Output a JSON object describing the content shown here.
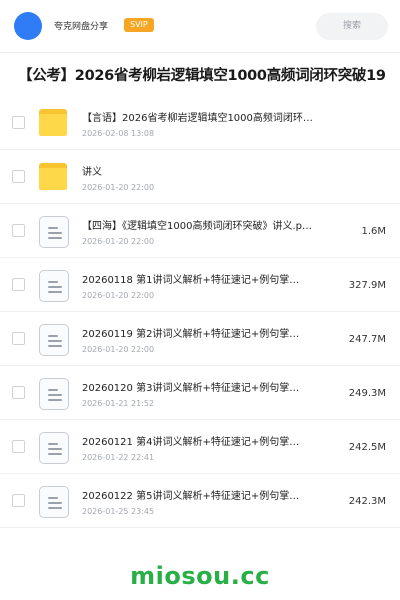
{
  "header": {
    "share_name": "夸克网盘分享",
    "badge": "SVIP",
    "search_placeholder": "搜索",
    "avatar_color": "#2f7cf6",
    "badge_color": "#f6a623"
  },
  "title": "【公考】2026省考柳岩逻辑填空1000高频词闭环突破19",
  "files": [
    {
      "type": "folder",
      "icon": "folder-icon",
      "name": "【言语】2026省考柳岩逻辑填空1000高频词闭环…",
      "date": "2026-02-08 13:08",
      "size": ""
    },
    {
      "type": "folder",
      "icon": "folder-icon",
      "name": "讲义",
      "date": "2026-01-20 22:00",
      "size": ""
    },
    {
      "type": "file",
      "icon": "document-icon",
      "name": "【四海】《逻辑填空1000高频词闭环突破》讲义.p…",
      "date": "2026-01-20 22:00",
      "size": "1.6M"
    },
    {
      "type": "file",
      "icon": "document-icon",
      "name": "20260118 第1讲词义解析+特征速记+例句掌…",
      "date": "2026-01-20 22:00",
      "size": "327.9M"
    },
    {
      "type": "file",
      "icon": "document-icon",
      "name": "20260119 第2讲词义解析+特征速记+例句掌…",
      "date": "2026-01-20 22:00",
      "size": "247.7M"
    },
    {
      "type": "file",
      "icon": "document-icon",
      "name": "20260120 第3讲词义解析+特征速记+例句掌…",
      "date": "2026-01-21 21:52",
      "size": "249.3M"
    },
    {
      "type": "file",
      "icon": "document-icon",
      "name": "20260121 第4讲词义解析+特征速记+例句掌…",
      "date": "2026-01-22 22:41",
      "size": "242.5M"
    },
    {
      "type": "file",
      "icon": "document-icon",
      "name": "20260122 第5讲词义解析+特征速记+例句掌…",
      "date": "2026-01-25 23:45",
      "size": "242.3M"
    }
  ],
  "watermark": "miosou.cc",
  "watermark_color": "#28b047"
}
